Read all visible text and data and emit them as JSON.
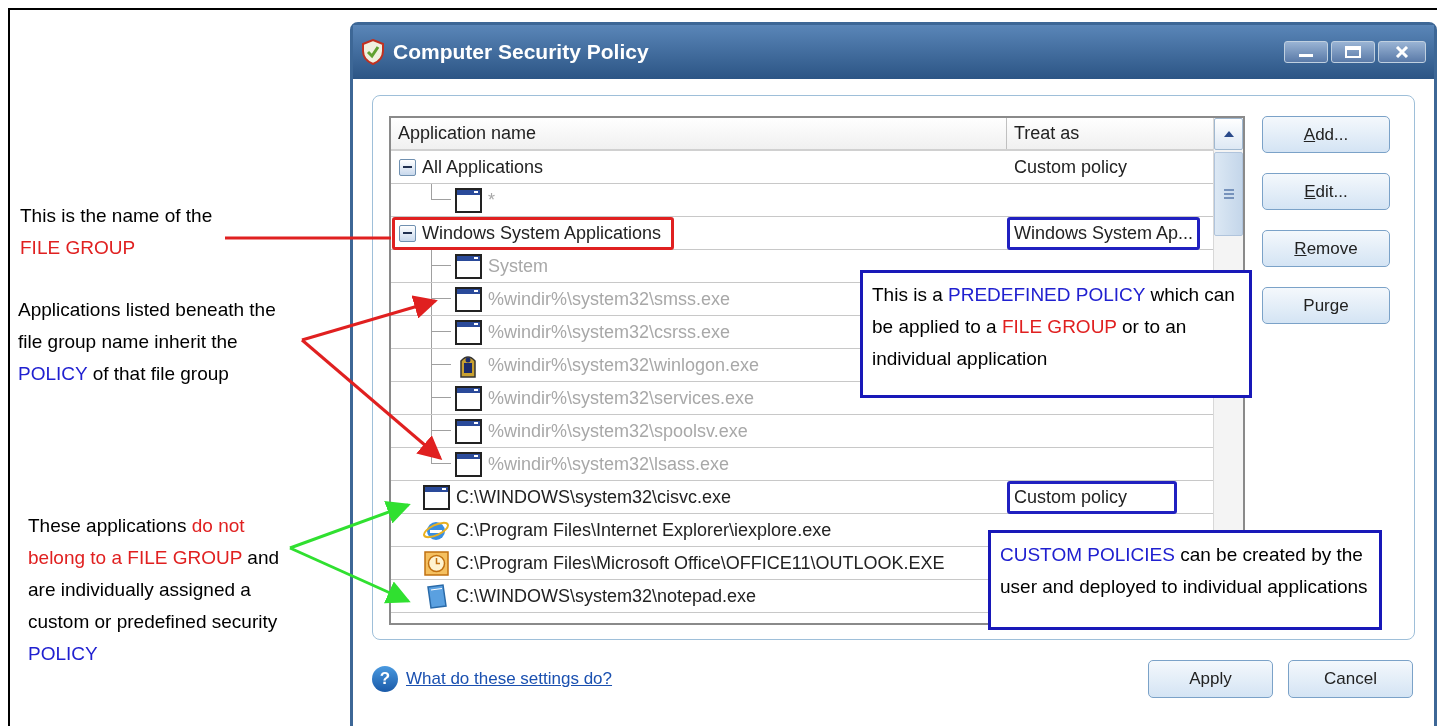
{
  "annotations": [
    {
      "segments": [
        {
          "text": "This is the name of the ",
          "kind": "plain"
        },
        {
          "text": "FILE GROUP",
          "kind": "red"
        }
      ]
    },
    {
      "segments": [
        {
          "text": "Applications listed beneath the file group name inherit the ",
          "kind": "plain"
        },
        {
          "text": "POLICY",
          "kind": "blue"
        },
        {
          "text": " of that file group",
          "kind": "plain"
        }
      ]
    },
    {
      "segments": [
        {
          "text": "These applications ",
          "kind": "plain"
        },
        {
          "text": "do not belong to a FILE GROUP",
          "kind": "red"
        },
        {
          "text": " and are individually assigned a custom or predefined security ",
          "kind": "plain"
        },
        {
          "text": "POLICY",
          "kind": "blue"
        }
      ]
    }
  ],
  "window": {
    "title": "Computer Security Policy"
  },
  "list": {
    "columns": [
      "Application name",
      "Treat as"
    ],
    "rows": [
      {
        "name": "All Applications",
        "treat_as": "Custom policy",
        "expanded": true,
        "dimmed": false,
        "children": [
          {
            "name": "*",
            "kind": "window",
            "dimmed": true
          }
        ]
      },
      {
        "name": "Windows System Applications",
        "treat_as": "Windows System Ap...",
        "expanded": true,
        "dimmed": false,
        "name_boxed": true,
        "policy_boxed": true,
        "children": [
          {
            "name": "System",
            "kind": "window",
            "dimmed": true
          },
          {
            "name": "%windir%\\system32\\smss.exe",
            "kind": "window",
            "dimmed": true
          },
          {
            "name": "%windir%\\system32\\csrss.exe",
            "kind": "window",
            "dimmed": true
          },
          {
            "name": "%windir%\\system32\\winlogon.exe",
            "kind": "winlogon",
            "dimmed": true
          },
          {
            "name": "%windir%\\system32\\services.exe",
            "kind": "window",
            "dimmed": true
          },
          {
            "name": "%windir%\\system32\\spoolsv.exe",
            "kind": "window",
            "dimmed": true
          },
          {
            "name": "%windir%\\system32\\lsass.exe",
            "kind": "window",
            "dimmed": true
          }
        ]
      },
      {
        "name": "C:\\WINDOWS\\system32\\cisvc.exe",
        "treat_as": "Custom policy",
        "kind": "window",
        "dimmed": false,
        "policy_boxed": true
      },
      {
        "name": "C:\\Program Files\\Internet Explorer\\iexplore.exe",
        "kind": "browser",
        "dimmed": false
      },
      {
        "name": "C:\\Program Files\\Microsoft Office\\OFFICE11\\OUTLOOK.EXE",
        "kind": "clock",
        "dimmed": false
      },
      {
        "name": "C:\\WINDOWS\\system32\\notepad.exe",
        "kind": "notepad",
        "dimmed": false
      }
    ]
  },
  "buttons": [
    {
      "label": "Add...",
      "access_key_underlined": true
    },
    {
      "label": "Edit...",
      "access_key_underlined": true
    },
    {
      "label": "Remove",
      "access_key_underlined": true
    },
    {
      "label": "Purge",
      "access_key_underlined": false
    }
  ],
  "callouts": [
    {
      "segments": [
        {
          "text": "This is a ",
          "kind": "plain"
        },
        {
          "text": "PREDEFINED POLICY",
          "kind": "blue"
        },
        {
          "text": " which can be applied to a ",
          "kind": "plain"
        },
        {
          "text": "FILE GROUP",
          "kind": "red"
        },
        {
          "text": " or to an individual application",
          "kind": "plain"
        }
      ]
    },
    {
      "segments": [
        {
          "text": "CUSTOM POLICIES",
          "kind": "blue"
        },
        {
          "text": " can be created by the user and deployed to individual applications",
          "kind": "plain"
        }
      ]
    }
  ],
  "help": {
    "icon": "?",
    "link": "What do these settings do?"
  },
  "footer_buttons": [
    "Apply",
    "Cancel"
  ]
}
